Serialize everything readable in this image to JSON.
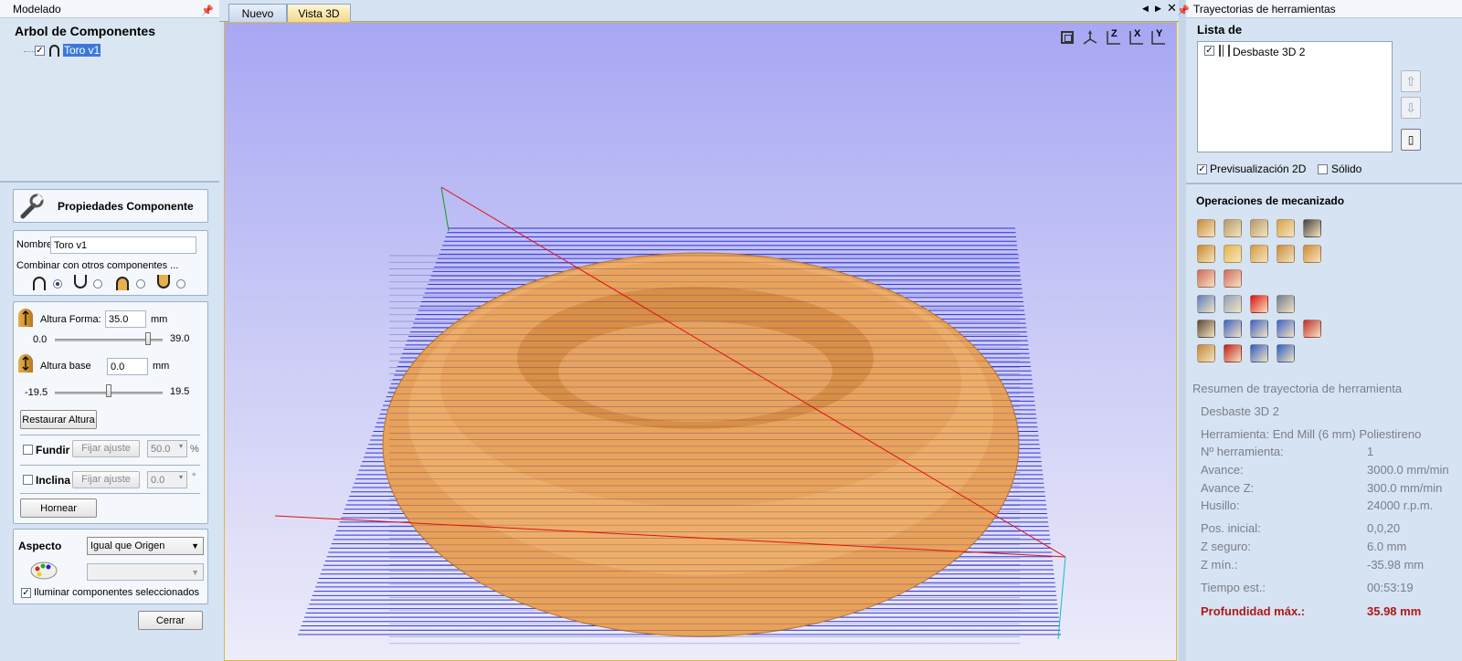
{
  "left": {
    "header_title": "Modelado",
    "tree_title": "Arbol de Componentes",
    "tree_item": "Toro v1",
    "props": {
      "title": "Propiedades Componente",
      "name_label": "Nombre",
      "name_value": "Toro v1",
      "combine_label": "Combinar con otros componentes ...",
      "altura_forma_label": "Altura Forma:",
      "altura_forma_value": "35.0",
      "altura_forma_unit": "mm",
      "altura_forma_min": "0.0",
      "altura_forma_max": "39.0",
      "altura_base_label": "Altura base",
      "altura_base_value": "0.0",
      "altura_base_unit": "mm",
      "altura_base_min": "-19.5",
      "altura_base_max": "19.5",
      "restore_btn": "Restaurar Altura",
      "fundir_label": "Fundir",
      "fundir_btn": "Fijar ajuste",
      "fundir_value": "50.0",
      "fundir_unit": "%",
      "inclina_label": "Inclina",
      "inclina_btn": "Fijar ajuste",
      "inclina_value": "0.0",
      "inclina_unit": "°",
      "hornear_btn": "Hornear",
      "aspecto_label": "Aspecto",
      "aspecto_value": "Igual que Origen",
      "iluminar_label": "Iluminar componentes seleccionados",
      "cerrar_btn": "Cerrar"
    }
  },
  "center": {
    "tabs": [
      "Nuevo",
      "Vista 3D"
    ],
    "active_tab": "Vista 3D",
    "view_buttons": [
      "Z",
      "X",
      "Y"
    ]
  },
  "right": {
    "header_title": "Trayectorias de herramientas",
    "list_title": "Lista de",
    "list_item": "Desbaste 3D 2",
    "preview2d_label": "Previsualización 2D",
    "solido_label": "Sólido",
    "ops_title": "Operaciones de mecanizado",
    "summary_title": "Resumen de trayectoria de herramienta",
    "summary_name": "Desbaste 3D 2",
    "herramienta": "Herramienta: End Mill (6 mm) Poliestireno",
    "rows": [
      {
        "k": "Nº herramienta:",
        "v": "1"
      },
      {
        "k": "Avance:",
        "v": "3000.0 mm/min"
      },
      {
        "k": "Avance Z:",
        "v": "300.0 mm/min"
      },
      {
        "k": "Husillo:",
        "v": "24000 r.p.m."
      },
      {
        "k": "Pos. inicial:",
        "v": "0,0,20"
      },
      {
        "k": "Z seguro:",
        "v": "6.0 mm"
      },
      {
        "k": "Z mín.:",
        "v": "-35.98 mm"
      },
      {
        "k": "Tiempo est.:",
        "v": "00:53:19"
      }
    ],
    "max_depth_label": "Profundidad máx.:",
    "max_depth_value": "35.98 mm"
  },
  "colors": {
    "toolpath": "#1a1ad6",
    "model": "#e8a25a",
    "viewport_top": "#a9a9f3",
    "viewport_bottom": "#eeeefa",
    "max_depth": "#b01818"
  }
}
